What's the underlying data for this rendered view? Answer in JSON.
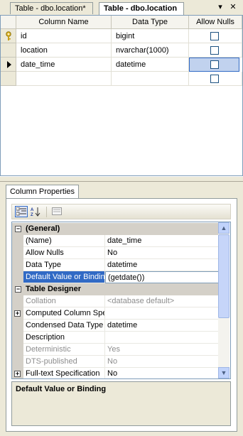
{
  "tabs": [
    {
      "label": "Table - dbo.location*",
      "active": false
    },
    {
      "label": "Table - dbo.location",
      "active": true
    }
  ],
  "tab_controls": {
    "dropdown": "▾",
    "close": "✕"
  },
  "grid": {
    "headers": [
      "Column Name",
      "Data Type",
      "Allow Nulls"
    ],
    "rows": [
      {
        "name": "id",
        "type": "bigint",
        "allow_nulls": false,
        "indicator": "key-icon"
      },
      {
        "name": "location",
        "type": "nvarchar(1000)",
        "allow_nulls": false,
        "indicator": ""
      },
      {
        "name": "date_time",
        "type": "datetime",
        "allow_nulls": false,
        "indicator": "row-pointer-icon"
      },
      {
        "name": "",
        "type": "",
        "allow_nulls": false,
        "indicator": ""
      }
    ]
  },
  "column_properties": {
    "tab_label": "Column Properties",
    "categories": [
      {
        "label": "(General)",
        "expanded": true,
        "properties": [
          {
            "name": "(Name)",
            "value": "date_time",
            "disabled": false
          },
          {
            "name": "Allow Nulls",
            "value": "No",
            "disabled": false
          },
          {
            "name": "Data Type",
            "value": "datetime",
            "disabled": false
          },
          {
            "name": "Default Value or Binding",
            "value": "(getdate())",
            "disabled": false,
            "selected": true
          }
        ]
      },
      {
        "label": "Table Designer",
        "expanded": true,
        "properties": [
          {
            "name": "Collation",
            "value": "<database default>",
            "disabled": true
          },
          {
            "name": "Computed Column Specification",
            "value": "",
            "disabled": false,
            "expandable": true
          },
          {
            "name": "Condensed Data Type",
            "value": "datetime",
            "disabled": false
          },
          {
            "name": "Description",
            "value": "",
            "disabled": false
          },
          {
            "name": "Deterministic",
            "value": "Yes",
            "disabled": true
          },
          {
            "name": "DTS-published",
            "value": "No",
            "disabled": true
          },
          {
            "name": "Full-text Specification",
            "value": "No",
            "disabled": false,
            "expandable": true
          }
        ]
      }
    ],
    "description_title": "Default Value or Binding"
  },
  "colors": {
    "selection": "#316ac5",
    "category_bg": "#d4d0c8",
    "window_bg": "#ece9d8"
  }
}
